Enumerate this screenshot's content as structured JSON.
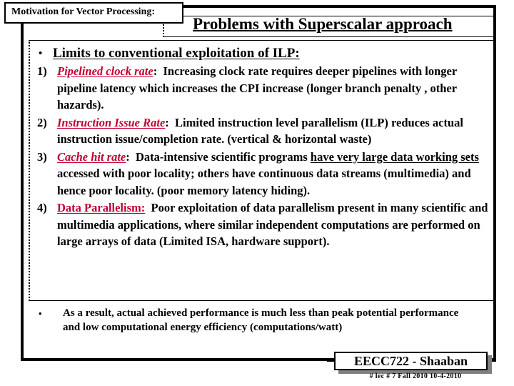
{
  "slide": {
    "motivation_label": "Motivation for Vector Processing:",
    "title": "Problems with Superscalar approach",
    "bullet_glyph": "•",
    "accent_color": "#C00030",
    "main_bullet": {
      "text": "Limits to conventional exploitation of ILP:"
    },
    "items": [
      {
        "number": "1)",
        "keyword": "Pipelined clock rate",
        "keyword_style": "italic",
        "colon": ":",
        "body": "Increasing clock rate requires deeper pipelines  with longer pipeline latency which increases the CPI increase (longer branch penalty , other hazards)."
      },
      {
        "number": "2)",
        "keyword": "Instruction Issue Rate",
        "keyword_style": "italic",
        "colon": ":",
        "body": "Limited instruction level parallelism (ILP) reduces actual instruction issue/completion rate. (vertical & horizontal waste)"
      },
      {
        "number": "3)",
        "keyword": "Cache hit rate",
        "keyword_style": "italic",
        "colon": ":",
        "body_part1": "Data-intensive scientific programs ",
        "body_underlined": "have very large data working sets",
        "body_part2": " accessed with poor locality;  others have continuous data streams (multimedia) and hence poor locality. (poor memory latency hiding)."
      },
      {
        "number": "4)",
        "keyword": "Data Parallelism:",
        "keyword_style": "upright",
        "colon": "",
        "body": "Poor exploitation of data parallelism present in many scientific and multimedia applications, where similar independent computations are performed on large arrays of data (Limited ISA, hardware support)."
      }
    ],
    "closing_bullet": "As a result, actual achieved performance is much less than peak potential performance and low computational energy efficiency (computations/watt)"
  },
  "footer": {
    "title": "EECC722 - Shaaban",
    "subtitle": "#  lec # 7    Fall 2010   10-4-2010"
  }
}
